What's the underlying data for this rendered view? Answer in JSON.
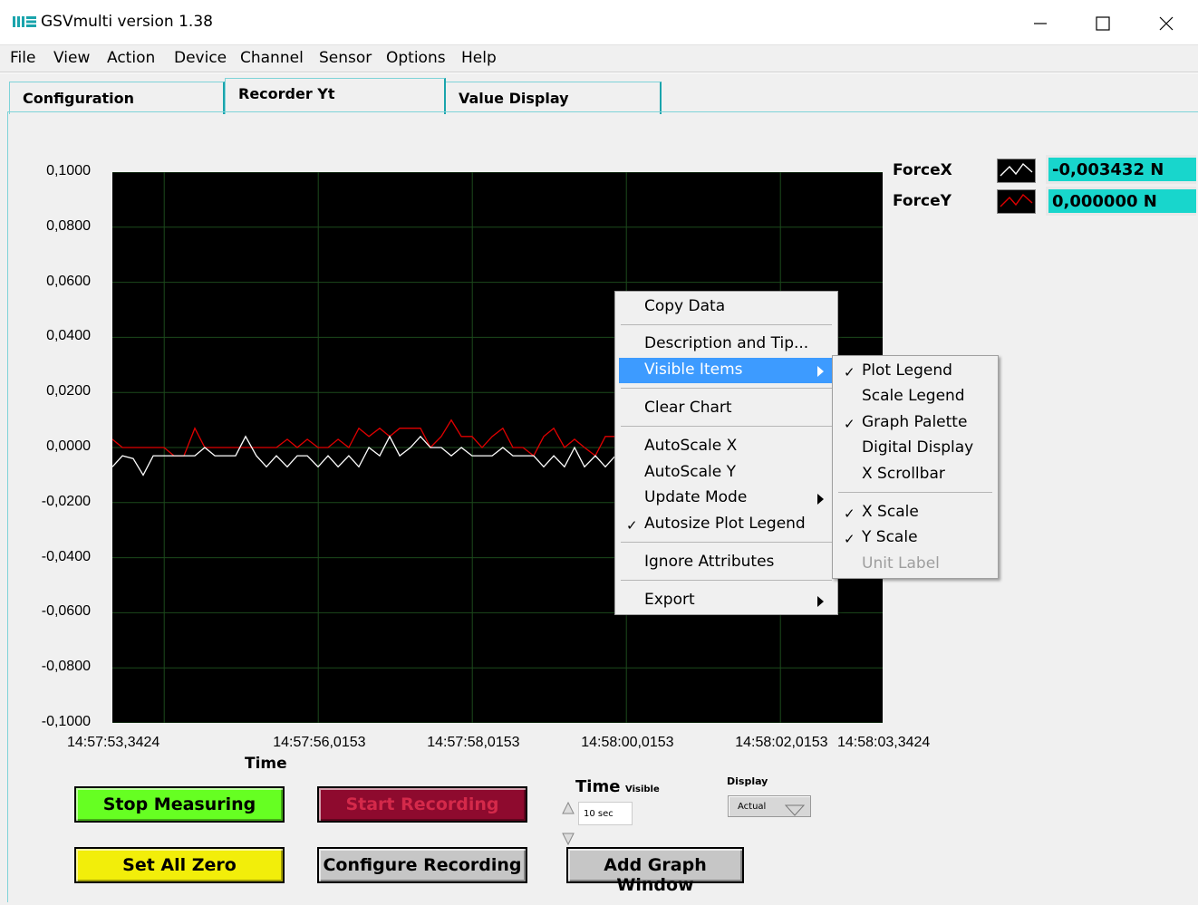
{
  "window": {
    "title": "GSVmulti version 1.38",
    "logo_icon": "me-logo-icon",
    "controls": [
      "minimize-icon",
      "maximize-icon",
      "close-icon"
    ]
  },
  "menubar": [
    "File",
    "View",
    "Action",
    "Device",
    "Channel",
    "Sensor",
    "Options",
    "Help"
  ],
  "tabs": [
    {
      "label": "Configuration",
      "active": false
    },
    {
      "label": "Recorder Yt",
      "active": true
    },
    {
      "label": "Value Display",
      "active": false
    }
  ],
  "chart_data": {
    "type": "line",
    "xlabel": "Time",
    "ylabel": "",
    "ylim": [
      -0.1,
      0.1
    ],
    "grid": true,
    "y_ticks": [
      "0,1000",
      "0,0800",
      "0,0600",
      "0,0400",
      "0,0200",
      "0,0000",
      "-0,0200",
      "-0,0400",
      "-0,0600",
      "-0,0800",
      "-0,1000"
    ],
    "x_ticks": [
      "14:57:53,3424",
      "14:57:56,0153",
      "14:57:58,0153",
      "14:58:00,0153",
      "14:58:02,0153",
      "14:58:03,3424"
    ],
    "x_tick_seconds": [
      0,
      2.673,
      4.673,
      6.673,
      8.673,
      10.0
    ],
    "legend_placement": "top-right",
    "series": [
      {
        "name": "ForceX",
        "color": "#ffffff",
        "x": [
          0,
          0.13,
          0.27,
          0.4,
          0.53,
          0.67,
          0.8,
          0.93,
          1.07,
          1.2,
          1.33,
          1.47,
          1.6,
          1.73,
          1.87,
          2.0,
          2.13,
          2.27,
          2.4,
          2.53,
          2.67,
          2.8,
          2.93,
          3.07,
          3.2,
          3.33,
          3.47,
          3.6,
          3.73,
          3.87,
          4.0,
          4.13,
          4.27,
          4.4,
          4.53,
          4.67,
          4.8,
          4.93,
          5.07,
          5.2,
          5.33,
          5.47,
          5.6,
          5.73,
          5.87,
          6.0,
          6.13,
          6.27,
          6.4,
          6.53,
          6.67
        ],
        "values": [
          -0.007,
          -0.003,
          -0.004,
          -0.01,
          -0.003,
          -0.003,
          -0.003,
          -0.003,
          -0.003,
          0.0,
          -0.003,
          -0.003,
          -0.003,
          0.004,
          -0.003,
          -0.007,
          -0.003,
          -0.007,
          -0.003,
          -0.003,
          -0.007,
          -0.003,
          -0.007,
          -0.003,
          -0.007,
          0.0,
          -0.003,
          0.004,
          -0.003,
          0.0,
          0.004,
          0.0,
          0.0,
          -0.003,
          0.0,
          -0.003,
          -0.003,
          -0.003,
          0.0,
          -0.003,
          -0.003,
          -0.003,
          -0.007,
          -0.003,
          -0.007,
          0.0,
          -0.007,
          -0.003,
          -0.007,
          -0.003,
          -0.003
        ]
      },
      {
        "name": "ForceY",
        "color": "#e00000",
        "x": [
          0,
          0.13,
          0.27,
          0.4,
          0.53,
          0.67,
          0.8,
          0.93,
          1.07,
          1.2,
          1.33,
          1.47,
          1.6,
          1.73,
          1.87,
          2.0,
          2.13,
          2.27,
          2.4,
          2.53,
          2.67,
          2.8,
          2.93,
          3.07,
          3.2,
          3.33,
          3.47,
          3.6,
          3.73,
          3.87,
          4.0,
          4.13,
          4.27,
          4.4,
          4.53,
          4.67,
          4.8,
          4.93,
          5.07,
          5.2,
          5.33,
          5.47,
          5.6,
          5.73,
          5.87,
          6.0,
          6.13,
          6.27,
          6.4,
          6.53,
          6.67
        ],
        "values": [
          0.003,
          0.0,
          0.0,
          0.0,
          0.0,
          0.0,
          -0.003,
          -0.003,
          0.007,
          0.0,
          0.0,
          0.0,
          0.0,
          0.0,
          0.0,
          0.0,
          0.0,
          0.003,
          0.0,
          0.003,
          0.0,
          0.0,
          0.003,
          0.0,
          0.007,
          0.004,
          0.007,
          0.004,
          0.007,
          0.007,
          0.007,
          0.0,
          0.004,
          0.01,
          0.004,
          0.004,
          0.0,
          0.004,
          0.007,
          0.0,
          0.0,
          -0.003,
          0.004,
          0.007,
          0.0,
          0.003,
          0.0,
          -0.003,
          0.004,
          0.004,
          -0.003
        ]
      }
    ]
  },
  "legend": [
    {
      "name": "ForceX",
      "value": "-0,003432 N",
      "swatch_color": "#ffffff"
    },
    {
      "name": "ForceY",
      "value": "0,000000 N",
      "swatch_color": "#e00000"
    }
  ],
  "buttons": {
    "stop_measuring": {
      "label": "Stop Measuring",
      "color": "#66ff22"
    },
    "start_recording": {
      "label": "Start Recording",
      "color": "#8e0a2e"
    },
    "set_all_zero": {
      "label": "Set All Zero",
      "color": "#f2ee0a"
    },
    "configure_recording": {
      "label": "Configure Recording",
      "color": "#c6c6c6"
    },
    "add_graph_window": {
      "label": "Add Graph Window",
      "color": "#c6c6c6"
    }
  },
  "time_control": {
    "label": "Time",
    "sublabel": "Visible",
    "value": "10 sec"
  },
  "display_control": {
    "label": "Display",
    "value": "Actual"
  },
  "context_menu": {
    "items": [
      {
        "label": "Copy Data"
      },
      {
        "label": "Description and Tip..."
      },
      {
        "label": "Visible Items",
        "submenu": true,
        "highlighted": true
      },
      {
        "label": "Clear Chart"
      },
      {
        "label": "AutoScale X"
      },
      {
        "label": "AutoScale Y"
      },
      {
        "label": "Update Mode",
        "submenu": true
      },
      {
        "label": "Autosize Plot Legend",
        "checked": true
      },
      {
        "label": "Ignore Attributes"
      },
      {
        "label": "Export",
        "submenu": true
      }
    ]
  },
  "submenu": {
    "items": [
      {
        "label": "Plot Legend",
        "checked": true
      },
      {
        "label": "Scale Legend",
        "checked": false
      },
      {
        "label": "Graph Palette",
        "checked": true
      },
      {
        "label": "Digital Display",
        "checked": false
      },
      {
        "label": "X Scrollbar",
        "checked": false
      },
      {
        "label": "X Scale",
        "checked": true
      },
      {
        "label": "Y Scale",
        "checked": true
      },
      {
        "label": "Unit Label",
        "checked": false,
        "disabled": true
      }
    ]
  }
}
